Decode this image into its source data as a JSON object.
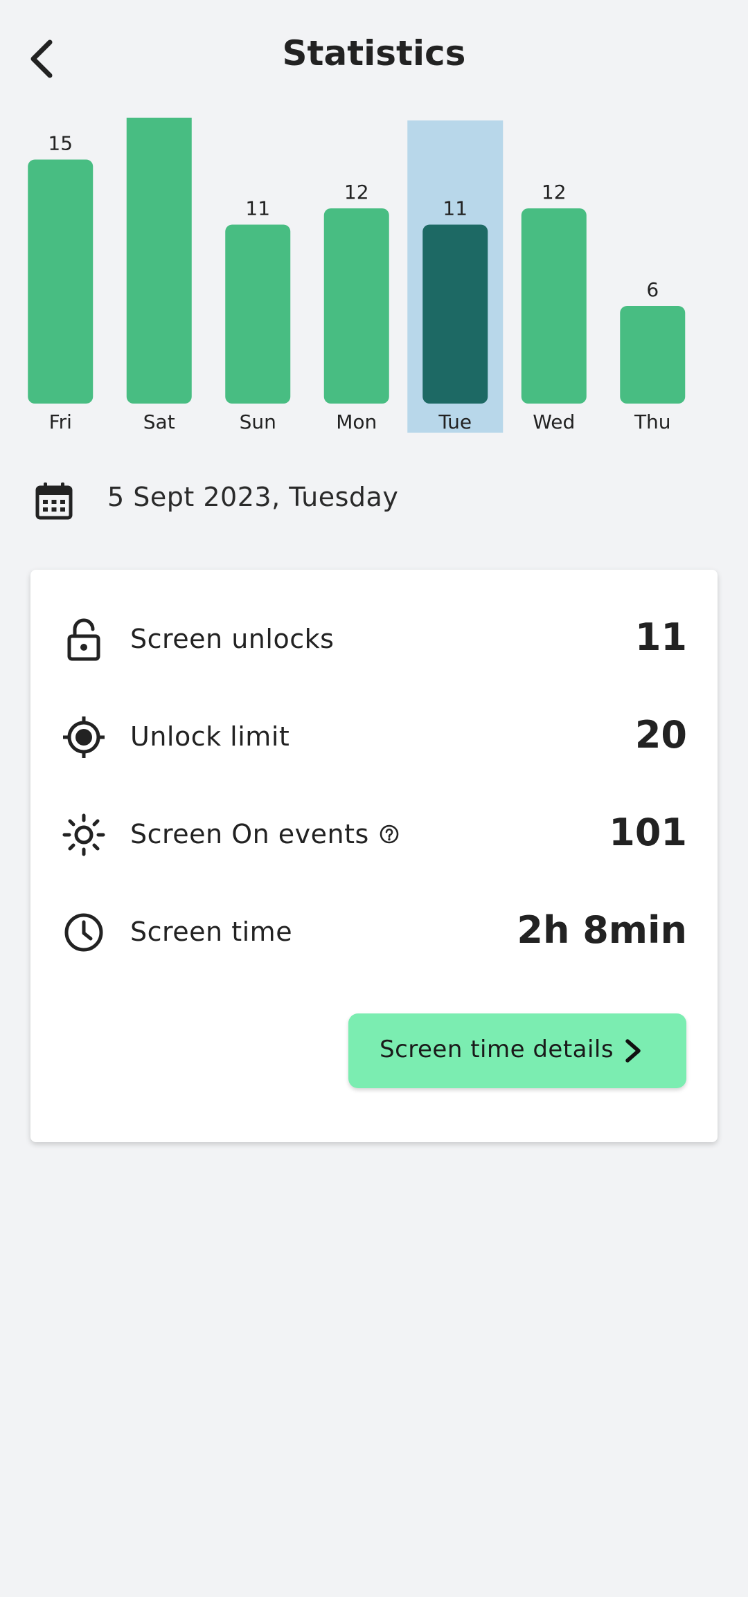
{
  "header": {
    "title": "Statistics",
    "back_icon": "chevron-left-icon"
  },
  "chart_data": {
    "type": "bar",
    "categories": [
      "Fri",
      "Sat",
      "Sun",
      "Mon",
      "Tue",
      "Wed",
      "Thu"
    ],
    "values": [
      15,
      18,
      11,
      12,
      11,
      12,
      6
    ],
    "selected_index": 4,
    "colors": {
      "bar": "#48bd82",
      "selected_bar": "#1d6964",
      "highlight": "#b8d7ea"
    },
    "grid": false,
    "legend": "none"
  },
  "date": {
    "icon": "calendar-icon",
    "text": "5 Sept 2023, Tuesday"
  },
  "stats": [
    {
      "icon": "unlock-icon",
      "label": "Screen unlocks",
      "value": "11"
    },
    {
      "icon": "target-icon",
      "label": "Unlock limit",
      "value": "20"
    },
    {
      "icon": "brightness-icon",
      "label": "Screen On events",
      "value": "101",
      "help_icon": "help-circle-icon"
    },
    {
      "icon": "clock-icon",
      "label": "Screen time",
      "value": "2h 8min"
    }
  ],
  "details_button": {
    "label": "Screen time details",
    "icon": "chevron-right-icon",
    "color": "#7bedb1"
  }
}
